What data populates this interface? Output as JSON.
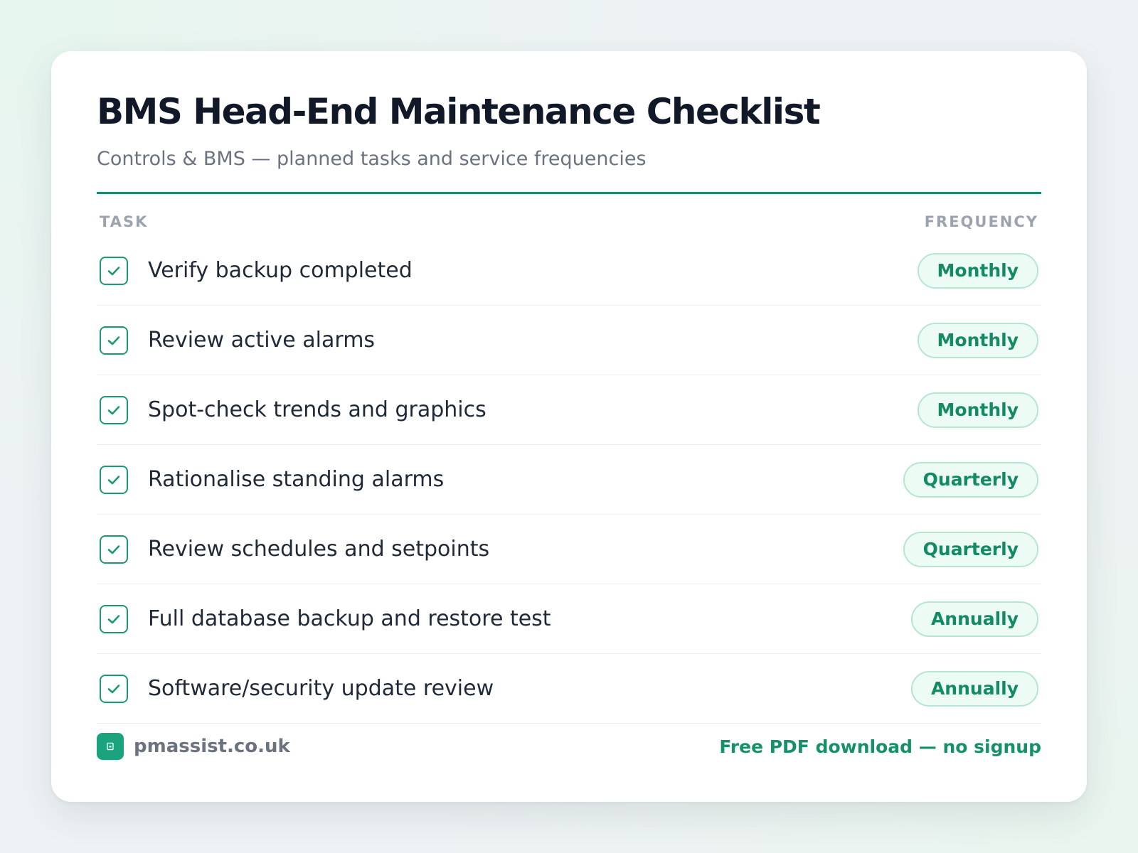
{
  "header": {
    "title": "BMS Head-End Maintenance Checklist",
    "subtitle": "Controls & BMS — planned tasks and service frequencies"
  },
  "columns": {
    "task": "TASK",
    "frequency": "FREQUENCY"
  },
  "tasks": [
    {
      "label": "Verify backup completed",
      "frequency": "Monthly",
      "checked": true
    },
    {
      "label": "Review active alarms",
      "frequency": "Monthly",
      "checked": true
    },
    {
      "label": "Spot-check trends and graphics",
      "frequency": "Monthly",
      "checked": true
    },
    {
      "label": "Rationalise standing alarms",
      "frequency": "Quarterly",
      "checked": true
    },
    {
      "label": "Review schedules and setpoints",
      "frequency": "Quarterly",
      "checked": true
    },
    {
      "label": "Full database backup and restore test",
      "frequency": "Annually",
      "checked": true
    },
    {
      "label": "Software/security update review",
      "frequency": "Annually",
      "checked": true
    }
  ],
  "footer": {
    "brand": "pmassist.co.uk",
    "cta": "Free PDF download — no signup"
  },
  "colors": {
    "accent": "#15906a",
    "pill_bg": "#ecfbf4",
    "pill_border": "#b4e6d0",
    "title": "#111827"
  },
  "icons": {
    "checkbox": "check-icon",
    "brand": "building-icon"
  }
}
